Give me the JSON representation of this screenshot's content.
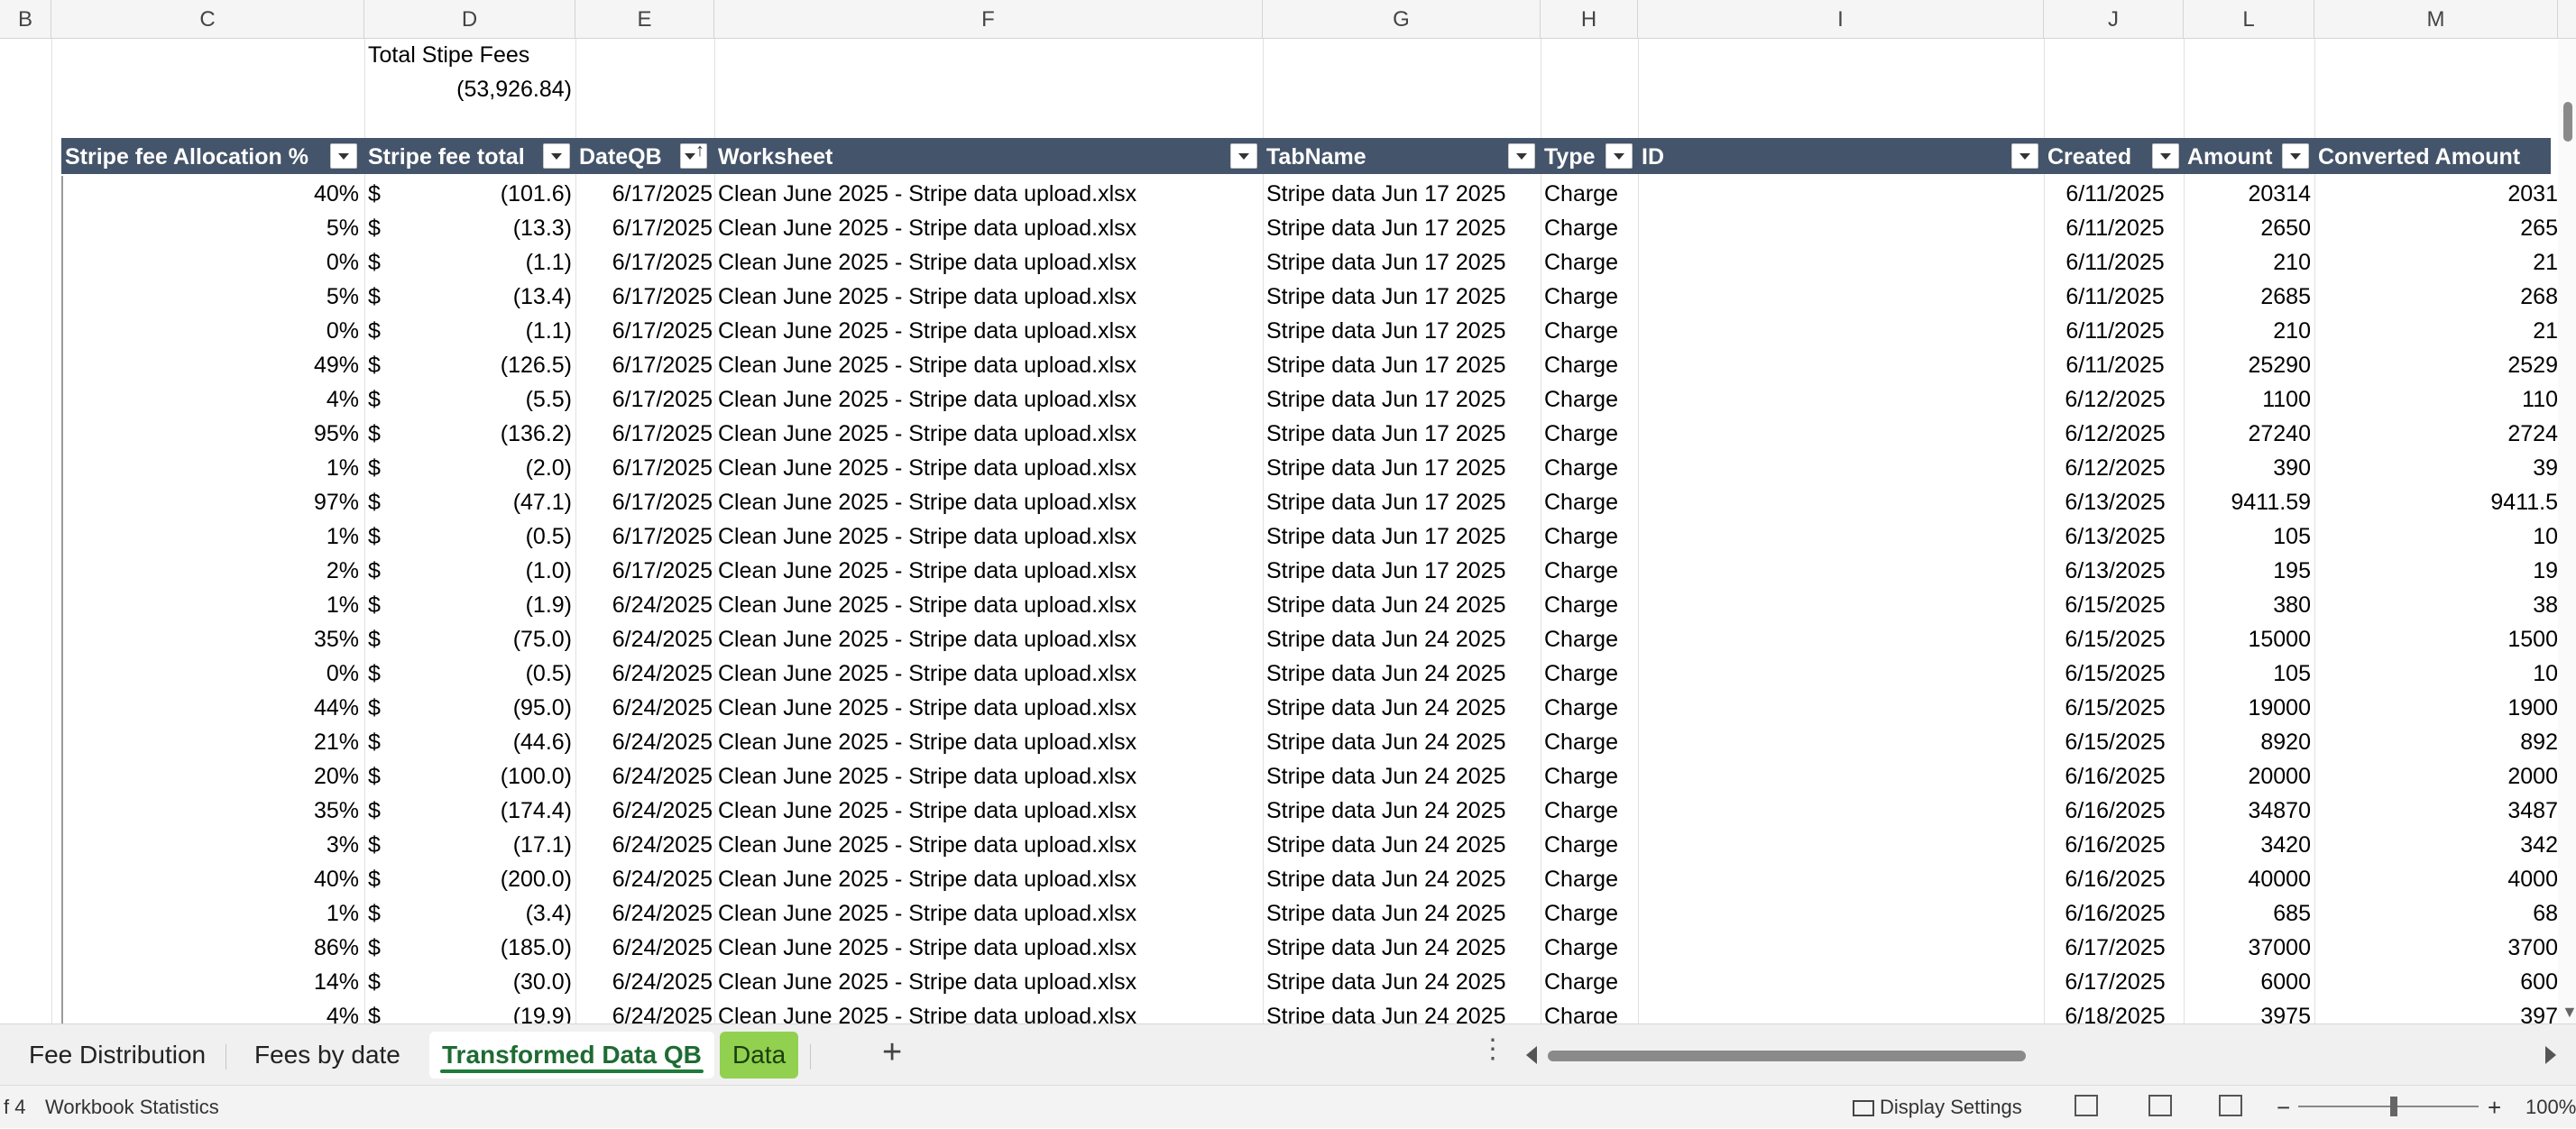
{
  "column_headers": [
    "B",
    "C",
    "D",
    "E",
    "F",
    "G",
    "H",
    "I",
    "J",
    "L",
    "M"
  ],
  "summary": {
    "label": "Total Stipe Fees",
    "value": "(53,926.84)"
  },
  "table": {
    "headers": [
      "Stripe fee Allocation %",
      "Stripe fee total",
      "DateQB",
      "Worksheet",
      "TabName",
      "Type",
      "ID",
      "Created",
      "Amount",
      "Converted Amount"
    ],
    "currency_symbol": "$",
    "rows": [
      [
        "40%",
        "(101.6)",
        "6/17/2025",
        "Clean June 2025 - Stripe data upload.xlsx",
        "Stripe data Jun 17 2025",
        "Charge",
        "6/11/2025",
        "20314",
        "2031"
      ],
      [
        "5%",
        "(13.3)",
        "6/17/2025",
        "Clean June 2025 - Stripe data upload.xlsx",
        "Stripe data Jun 17 2025",
        "Charge",
        "6/11/2025",
        "2650",
        "265"
      ],
      [
        "0%",
        "(1.1)",
        "6/17/2025",
        "Clean June 2025 - Stripe data upload.xlsx",
        "Stripe data Jun 17 2025",
        "Charge",
        "6/11/2025",
        "210",
        "21"
      ],
      [
        "5%",
        "(13.4)",
        "6/17/2025",
        "Clean June 2025 - Stripe data upload.xlsx",
        "Stripe data Jun 17 2025",
        "Charge",
        "6/11/2025",
        "2685",
        "268"
      ],
      [
        "0%",
        "(1.1)",
        "6/17/2025",
        "Clean June 2025 - Stripe data upload.xlsx",
        "Stripe data Jun 17 2025",
        "Charge",
        "6/11/2025",
        "210",
        "21"
      ],
      [
        "49%",
        "(126.5)",
        "6/17/2025",
        "Clean June 2025 - Stripe data upload.xlsx",
        "Stripe data Jun 17 2025",
        "Charge",
        "6/11/2025",
        "25290",
        "2529"
      ],
      [
        "4%",
        "(5.5)",
        "6/17/2025",
        "Clean June 2025 - Stripe data upload.xlsx",
        "Stripe data Jun 17 2025",
        "Charge",
        "6/12/2025",
        "1100",
        "110"
      ],
      [
        "95%",
        "(136.2)",
        "6/17/2025",
        "Clean June 2025 - Stripe data upload.xlsx",
        "Stripe data Jun 17 2025",
        "Charge",
        "6/12/2025",
        "27240",
        "2724"
      ],
      [
        "1%",
        "(2.0)",
        "6/17/2025",
        "Clean June 2025 - Stripe data upload.xlsx",
        "Stripe data Jun 17 2025",
        "Charge",
        "6/12/2025",
        "390",
        "39"
      ],
      [
        "97%",
        "(47.1)",
        "6/17/2025",
        "Clean June 2025 - Stripe data upload.xlsx",
        "Stripe data Jun 17 2025",
        "Charge",
        "6/13/2025",
        "9411.59",
        "9411.5"
      ],
      [
        "1%",
        "(0.5)",
        "6/17/2025",
        "Clean June 2025 - Stripe data upload.xlsx",
        "Stripe data Jun 17 2025",
        "Charge",
        "6/13/2025",
        "105",
        "10"
      ],
      [
        "2%",
        "(1.0)",
        "6/17/2025",
        "Clean June 2025 - Stripe data upload.xlsx",
        "Stripe data Jun 17 2025",
        "Charge",
        "6/13/2025",
        "195",
        "19"
      ],
      [
        "1%",
        "(1.9)",
        "6/24/2025",
        "Clean June 2025 - Stripe data upload.xlsx",
        "Stripe data Jun 24 2025",
        "Charge",
        "6/15/2025",
        "380",
        "38"
      ],
      [
        "35%",
        "(75.0)",
        "6/24/2025",
        "Clean June 2025 - Stripe data upload.xlsx",
        "Stripe data Jun 24 2025",
        "Charge",
        "6/15/2025",
        "15000",
        "1500"
      ],
      [
        "0%",
        "(0.5)",
        "6/24/2025",
        "Clean June 2025 - Stripe data upload.xlsx",
        "Stripe data Jun 24 2025",
        "Charge",
        "6/15/2025",
        "105",
        "10"
      ],
      [
        "44%",
        "(95.0)",
        "6/24/2025",
        "Clean June 2025 - Stripe data upload.xlsx",
        "Stripe data Jun 24 2025",
        "Charge",
        "6/15/2025",
        "19000",
        "1900"
      ],
      [
        "21%",
        "(44.6)",
        "6/24/2025",
        "Clean June 2025 - Stripe data upload.xlsx",
        "Stripe data Jun 24 2025",
        "Charge",
        "6/15/2025",
        "8920",
        "892"
      ],
      [
        "20%",
        "(100.0)",
        "6/24/2025",
        "Clean June 2025 - Stripe data upload.xlsx",
        "Stripe data Jun 24 2025",
        "Charge",
        "6/16/2025",
        "20000",
        "2000"
      ],
      [
        "35%",
        "(174.4)",
        "6/24/2025",
        "Clean June 2025 - Stripe data upload.xlsx",
        "Stripe data Jun 24 2025",
        "Charge",
        "6/16/2025",
        "34870",
        "3487"
      ],
      [
        "3%",
        "(17.1)",
        "6/24/2025",
        "Clean June 2025 - Stripe data upload.xlsx",
        "Stripe data Jun 24 2025",
        "Charge",
        "6/16/2025",
        "3420",
        "342"
      ],
      [
        "40%",
        "(200.0)",
        "6/24/2025",
        "Clean June 2025 - Stripe data upload.xlsx",
        "Stripe data Jun 24 2025",
        "Charge",
        "6/16/2025",
        "40000",
        "4000"
      ],
      [
        "1%",
        "(3.4)",
        "6/24/2025",
        "Clean June 2025 - Stripe data upload.xlsx",
        "Stripe data Jun 24 2025",
        "Charge",
        "6/16/2025",
        "685",
        "68"
      ],
      [
        "86%",
        "(185.0)",
        "6/24/2025",
        "Clean June 2025 - Stripe data upload.xlsx",
        "Stripe data Jun 24 2025",
        "Charge",
        "6/17/2025",
        "37000",
        "3700"
      ],
      [
        "14%",
        "(30.0)",
        "6/24/2025",
        "Clean June 2025 - Stripe data upload.xlsx",
        "Stripe data Jun 24 2025",
        "Charge",
        "6/17/2025",
        "6000",
        "600"
      ],
      [
        "4%",
        "(19.9)",
        "6/24/2025",
        "Clean June 2025 - Stripe data upload.xlsx",
        "Stripe data Jun 24 2025",
        "Charge",
        "6/18/2025",
        "3975",
        "397"
      ]
    ]
  },
  "sheet_tabs": [
    {
      "label": "Fee Distribution",
      "active": false
    },
    {
      "label": "Fees by date",
      "active": false
    },
    {
      "label": "Transformed Data QB",
      "active": true
    },
    {
      "label": "Data",
      "active": false,
      "color": "#92d050"
    }
  ],
  "status_bar": {
    "left_text": "f 4",
    "workbook_statistics": "Workbook Statistics",
    "display_settings": "Display Settings",
    "zoom": "100%"
  },
  "colors": {
    "table_header_bg": "#44546a",
    "active_tab": "#1e7b3a",
    "data_tab": "#92d050"
  },
  "icons": [
    "filter-dropdown-icon",
    "sort-ascending-icon",
    "add-sheet-icon",
    "more-options-icon",
    "display-settings-icon",
    "normal-view-icon",
    "page-layout-icon",
    "page-break-icon",
    "zoom-out-icon",
    "zoom-in-icon"
  ]
}
